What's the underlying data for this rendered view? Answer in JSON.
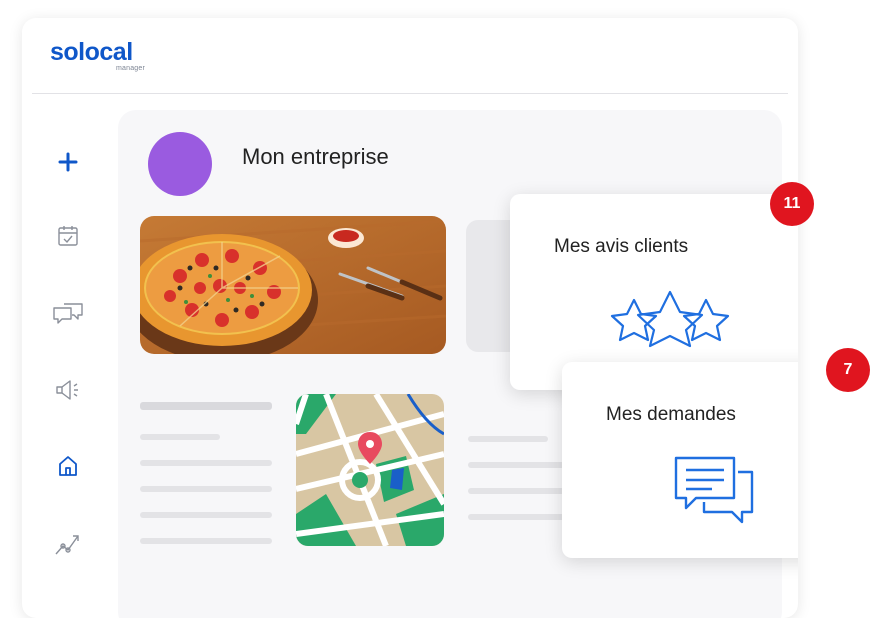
{
  "logo": {
    "brand_part1": "solo",
    "brand_part2": "cal",
    "sub": "manager"
  },
  "colors": {
    "brand_blue": "#0f57c9",
    "avatar_purple": "#9a5be0",
    "badge_red": "#e0151f",
    "icon_gray": "#8a8f99"
  },
  "sidebar": {
    "items": [
      {
        "icon": "plus-icon"
      },
      {
        "icon": "calendar-check-icon"
      },
      {
        "icon": "chat-bubbles-icon"
      },
      {
        "icon": "megaphone-icon"
      },
      {
        "icon": "home-icon"
      },
      {
        "icon": "trend-chart-icon"
      }
    ]
  },
  "business": {
    "name": "Mon entreprise"
  },
  "cards": {
    "reviews": {
      "title": "Mes avis clients",
      "badge": "11",
      "icon": "stars-icon"
    },
    "requests": {
      "title": "Mes demandes",
      "badge": "7",
      "icon": "messages-icon"
    }
  }
}
